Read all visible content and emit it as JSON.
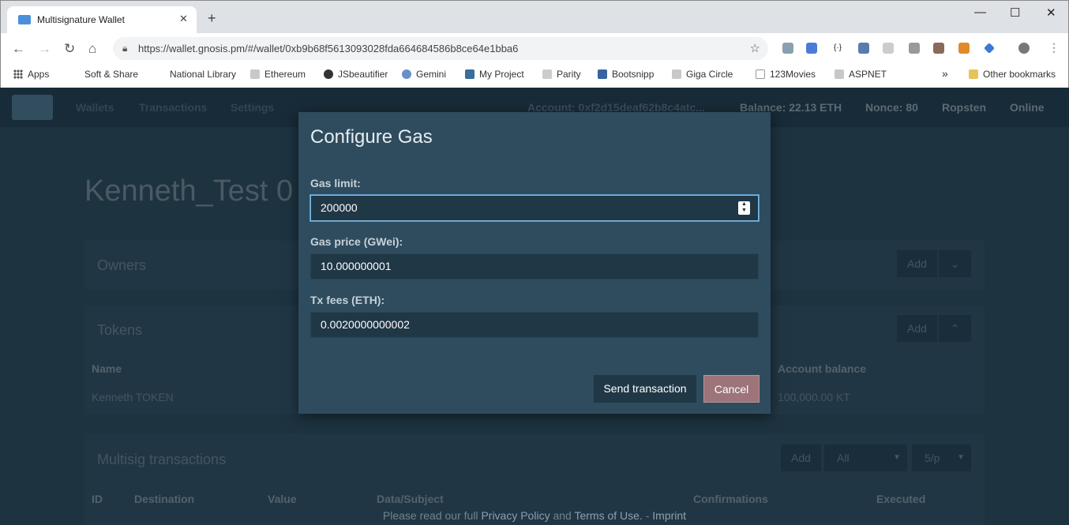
{
  "browser": {
    "tab_title": "Multisignature Wallet",
    "url": "https://wallet.gnosis.pm/#/wallet/0xb9b68f5613093028fda664684586b8ce64e1bba6",
    "bookmarks": [
      "Apps",
      "Soft & Share",
      "National Library",
      "Ethereum",
      "JSbeautifier",
      "Gemini",
      "My Project",
      "Parity",
      "Bootsnipp",
      "Giga Circle",
      "123Movies",
      "ASPNET"
    ],
    "more": "»",
    "other_bookmarks": "Other bookmarks"
  },
  "nav": {
    "links": [
      "Wallets",
      "Transactions",
      "Settings"
    ],
    "account": "Account: 0xf2d15deaf62b8c4atc...",
    "balance": "Balance: 22.13 ETH",
    "nonce": "Nonce: 80",
    "network": "Ropsten",
    "status": "Online"
  },
  "page": {
    "wallet_title": "Kenneth_Test 0",
    "owners": {
      "title": "Owners",
      "add": "Add"
    },
    "tokens": {
      "title": "Tokens",
      "add": "Add",
      "col_name": "Name",
      "col_balance": "Account balance",
      "row_name": "Kenneth TOKEN",
      "row_balance": "100,000.00 KT"
    },
    "multisig": {
      "title": "Multisig transactions",
      "add": "Add",
      "filter": "All",
      "per_page": "5/p",
      "cols": [
        "ID",
        "Destination",
        "Value",
        "Data/Subject",
        "Confirmations",
        "Executed"
      ]
    },
    "footer": {
      "prefix": "Please read our full ",
      "privacy": "Privacy Policy",
      "and": " and ",
      "terms": "Terms of Use.",
      "sep": " - ",
      "imprint": "Imprint"
    }
  },
  "modal": {
    "title": "Configure Gas",
    "gas_limit_label": "Gas limit:",
    "gas_limit": "200000",
    "gas_price_label": "Gas price (GWei):",
    "gas_price": "10.000000001",
    "tx_fees_label": "Tx fees (ETH):",
    "tx_fees": "0.0020000000002",
    "send": "Send transaction",
    "cancel": "Cancel"
  }
}
